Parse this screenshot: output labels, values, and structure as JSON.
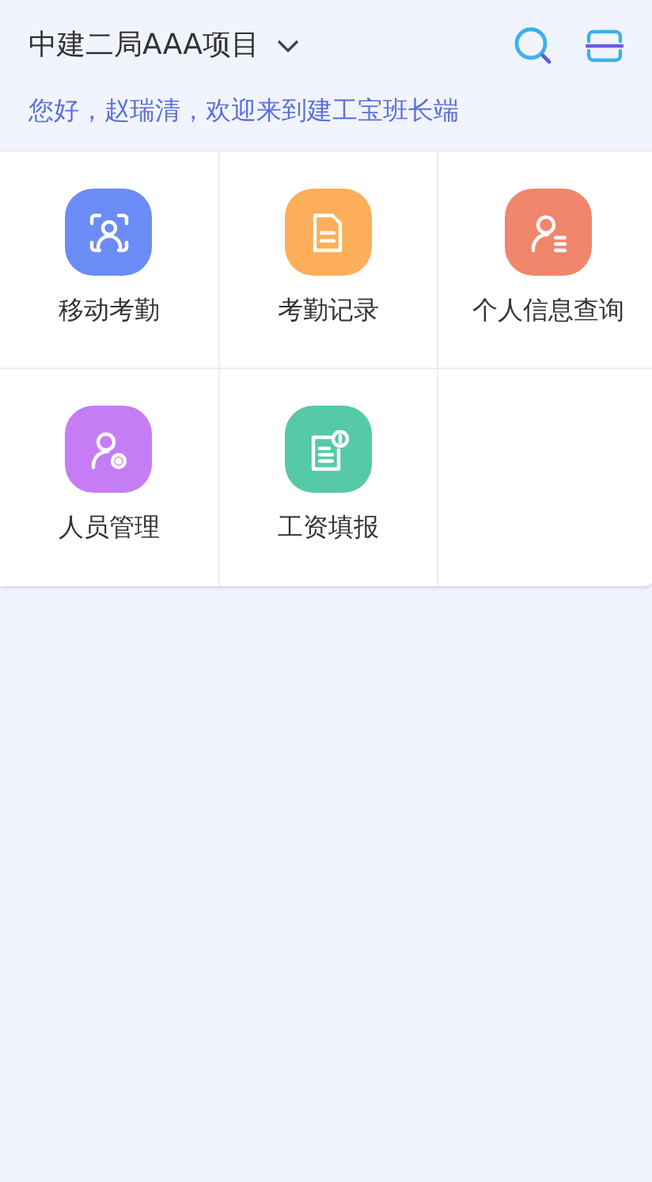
{
  "header": {
    "project": "中建二局AAA项目",
    "greeting": "您好，赵瑞清，欢迎来到建工宝班长端"
  },
  "tiles": [
    {
      "label": "移动考勤",
      "kind": "face",
      "color": "#6b8cf7"
    },
    {
      "label": "考勤记录",
      "kind": "document",
      "color": "#fcae5a"
    },
    {
      "label": "个人信息查询",
      "kind": "person-list",
      "color": "#f0866c"
    },
    {
      "label": "人员管理",
      "kind": "person-gear",
      "color": "#c57cf5"
    },
    {
      "label": "工资填报",
      "kind": "form-coin",
      "color": "#56c9a6"
    }
  ]
}
